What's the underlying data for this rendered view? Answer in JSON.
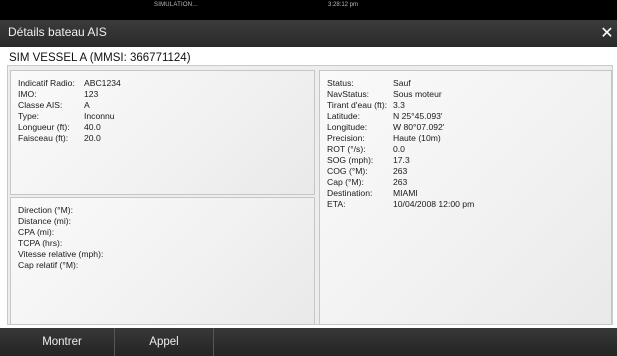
{
  "statusbar": {
    "mode": "SIMULATION...",
    "time": "3:28:12 pm"
  },
  "window": {
    "title": "Détails bateau AIS",
    "close_icon": "✕"
  },
  "vessel": {
    "name": "SIM VESSEL A (MMSI: 366771124)"
  },
  "identity": [
    {
      "label": "Indicatif Radio:",
      "value": "ABC1234"
    },
    {
      "label": "IMO:",
      "value": "123"
    },
    {
      "label": "Classe AIS:",
      "value": "A"
    },
    {
      "label": "Type:",
      "value": "Inconnu"
    },
    {
      "label": "Longueur (ft):",
      "value": "40.0"
    },
    {
      "label": "Faisceau (ft):",
      "value": "20.0"
    }
  ],
  "relative": [
    {
      "label": "Direction (°M):"
    },
    {
      "label": "Distance (mi):"
    },
    {
      "label": "CPA (mi):"
    },
    {
      "label": "TCPA (hrs):"
    },
    {
      "label": "Vitesse relative (mph):"
    },
    {
      "label": "Cap relatif (°M):"
    }
  ],
  "status": [
    {
      "label": "Status:",
      "value": "Sauf"
    },
    {
      "label": "NavStatus:",
      "value": "Sous moteur"
    },
    {
      "label": "Tirant d'eau (ft):",
      "value": "3.3"
    },
    {
      "label": "Latitude:",
      "value": "N 25°45.093'"
    },
    {
      "label": "Longitude:",
      "value": "W 80°07.092'"
    },
    {
      "label": "Precision:",
      "value": "Haute (10m)"
    },
    {
      "label": "ROT (°/s):",
      "value": "0.0"
    },
    {
      "label": "SOG (mph):",
      "value": "17.3"
    },
    {
      "label": "COG (°M):",
      "value": "263"
    },
    {
      "label": "Cap (°M):",
      "value": "263"
    },
    {
      "label": "Destination:",
      "value": "MIAMI"
    },
    {
      "label": "ETA:",
      "value": "10/04/2008 12:00 pm"
    }
  ],
  "buttons": {
    "show": "Montrer",
    "call": "Appel"
  }
}
